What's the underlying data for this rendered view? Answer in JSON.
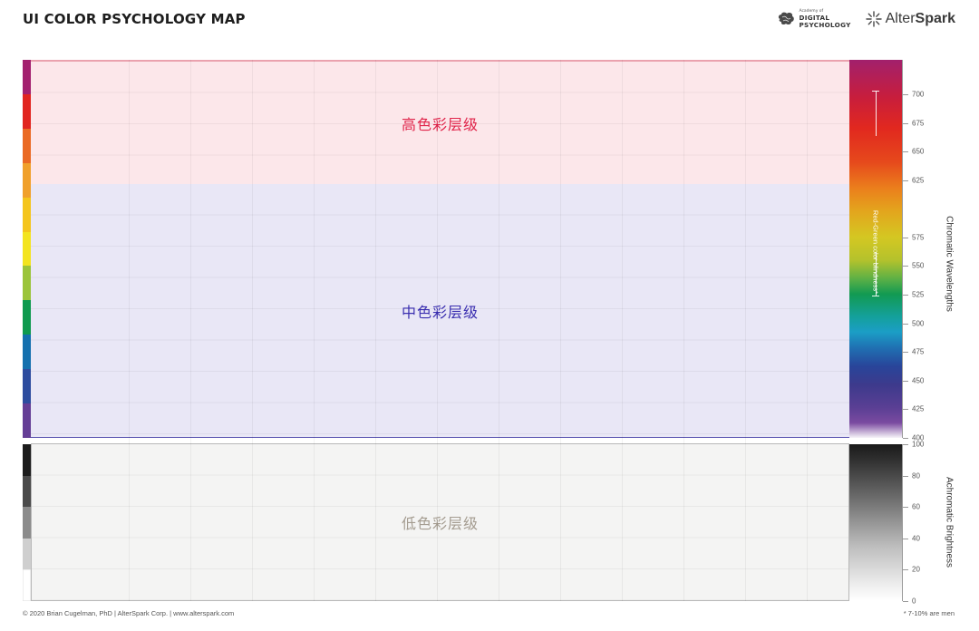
{
  "title": "UI COLOR PSYCHOLOGY MAP",
  "logos": {
    "adp_small": "Academy of",
    "adp_line1": "DIGITAL",
    "adp_line2": "PSYCHOLOGY",
    "alter_light": "Alter",
    "alter_bold": "Spark"
  },
  "bands": {
    "high": "高色彩层级",
    "mid": "中色彩层级",
    "low": "低色彩层级"
  },
  "chroma_swatch_colors": [
    "#a3206f",
    "#e1251f",
    "#ea6a24",
    "#f0a02b",
    "#f4c51c",
    "#f3e41f",
    "#9bc43a",
    "#0f9a4f",
    "#1470ae",
    "#2d4c9f",
    "#653e96"
  ],
  "gray_swatch_colors": [
    "#1c1c1c",
    "#4a4a4a",
    "#8b8b8b",
    "#cfcfcf",
    "#ffffff"
  ],
  "colorblind_label": "Red-Green color blindness*",
  "chromatic_axis": {
    "title": "Chromatic Wavelengths",
    "min": 400,
    "max": 730,
    "ticks": [
      "700",
      "675",
      "650",
      "625",
      "575",
      "550",
      "525",
      "500",
      "475",
      "450",
      "425",
      "400"
    ]
  },
  "achromatic_axis": {
    "title": "Achromatic Brightness",
    "min": 0,
    "max": 100,
    "ticks": [
      "100",
      "80",
      "60",
      "40",
      "20",
      "0"
    ]
  },
  "footer": {
    "left": "© 2020 Brian Cugelman, PhD   |  AlterSpark Corp.   |  www.alterspark.com",
    "right": "* 7-10% are men"
  }
}
